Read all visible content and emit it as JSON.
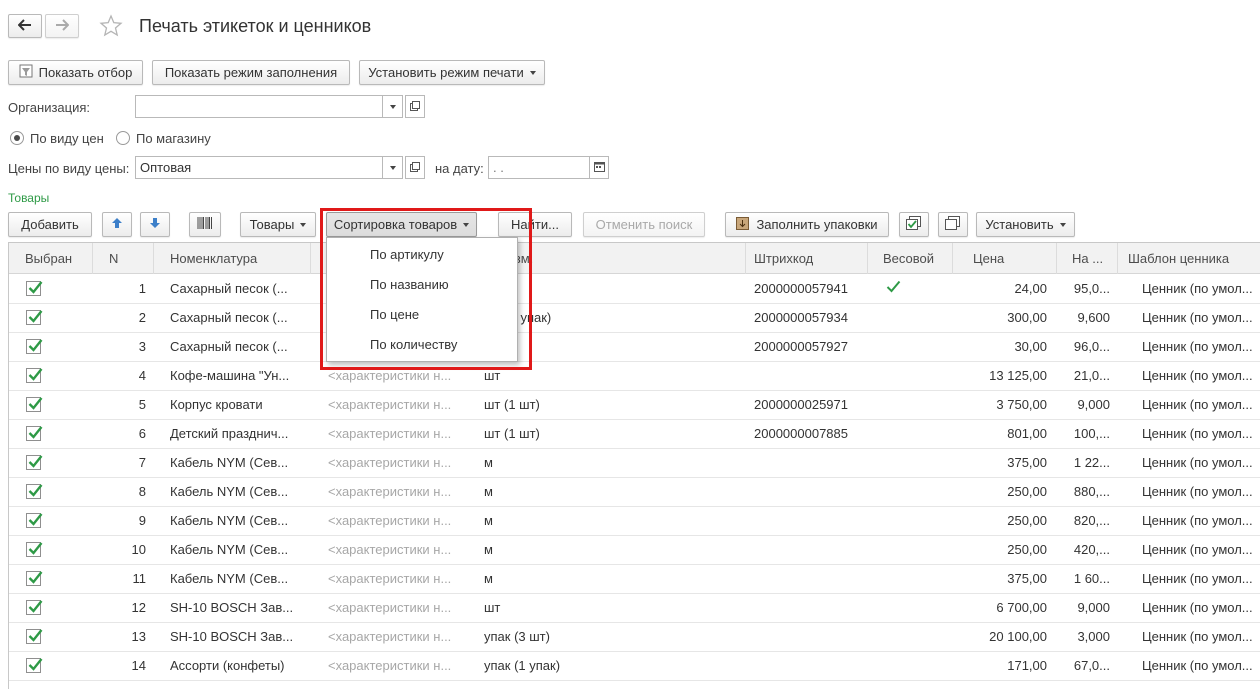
{
  "window": {
    "title": "Печать этикеток и ценников",
    "back_icon": "arrow-left-icon",
    "forward_icon": "arrow-right-icon",
    "favorite_icon": "star-icon"
  },
  "toolbar": {
    "show_filter": "Показать отбор",
    "show_fill_mode": "Показать режим заполнения",
    "set_print_mode": "Установить режим печати"
  },
  "form": {
    "organization_label": "Организация:",
    "organization_value": "",
    "radio_price_type": "По виду цен",
    "radio_store": "По магазину",
    "price_type_label": "Цены по виду цены:",
    "price_type_value": "Оптовая",
    "date_label": "на дату:",
    "date_value": " .  ."
  },
  "goods": {
    "section_title": "Товары",
    "add": "Добавить",
    "goods_menu": "Товары",
    "sort_menu": "Сортировка товаров",
    "find": "Найти...",
    "cancel_search": "Отменить поиск",
    "fill_packages": "Заполнить упаковки",
    "set": "Установить"
  },
  "sort_menu_items": [
    "По артикулу",
    "По названию",
    "По цене",
    "По количеству"
  ],
  "columns": [
    "Выбран",
    "N",
    "Номенклатура",
    "",
    "Ед. изм.",
    "Штрихкод",
    "Весовой",
    "Цена",
    "На ...",
    "Шаблон ценника"
  ],
  "rows": [
    {
      "n": "1",
      "name": "Сахарный песок (...",
      "char": "",
      "unit": "",
      "barcode": "2000000057941",
      "weight": true,
      "price": "24,00",
      "qty": "95,0...",
      "tpl": "Ценник (по умол..."
    },
    {
      "n": "2",
      "name": "Сахарный песок (...",
      "char": "",
      "unit": "кг (10 упак)",
      "barcode": "2000000057934",
      "weight": false,
      "price": "300,00",
      "qty": "9,600",
      "tpl": "Ценник (по умол..."
    },
    {
      "n": "3",
      "name": "Сахарный песок (...",
      "char": "",
      "unit": "",
      "barcode": "2000000057927",
      "weight": false,
      "price": "30,00",
      "qty": "96,0...",
      "tpl": "Ценник (по умол..."
    },
    {
      "n": "4",
      "name": "Кофе-машина \"Ун...",
      "char": "<характеристики н...",
      "unit": "шт",
      "barcode": "",
      "weight": false,
      "price": "13 125,00",
      "qty": "21,0...",
      "tpl": "Ценник (по умол..."
    },
    {
      "n": "5",
      "name": "Корпус кровати",
      "char": "<характеристики н...",
      "unit": "шт (1 шт)",
      "barcode": "2000000025971",
      "weight": false,
      "price": "3 750,00",
      "qty": "9,000",
      "tpl": "Ценник (по умол..."
    },
    {
      "n": "6",
      "name": "Детский празднич...",
      "char": "<характеристики н...",
      "unit": "шт (1 шт)",
      "barcode": "2000000007885",
      "weight": false,
      "price": "801,00",
      "qty": "100,...",
      "tpl": "Ценник (по умол..."
    },
    {
      "n": "7",
      "name": "Кабель NYM (Сев...",
      "char": "<характеристики н...",
      "unit": "м",
      "barcode": "",
      "weight": false,
      "price": "375,00",
      "qty": "1 22...",
      "tpl": "Ценник (по умол..."
    },
    {
      "n": "8",
      "name": "Кабель NYM (Сев...",
      "char": "<характеристики н...",
      "unit": "м",
      "barcode": "",
      "weight": false,
      "price": "250,00",
      "qty": "880,...",
      "tpl": "Ценник (по умол..."
    },
    {
      "n": "9",
      "name": "Кабель NYM (Сев...",
      "char": "<характеристики н...",
      "unit": "м",
      "barcode": "",
      "weight": false,
      "price": "250,00",
      "qty": "820,...",
      "tpl": "Ценник (по умол..."
    },
    {
      "n": "10",
      "name": "Кабель NYM (Сев...",
      "char": "<характеристики н...",
      "unit": "м",
      "barcode": "",
      "weight": false,
      "price": "250,00",
      "qty": "420,...",
      "tpl": "Ценник (по умол..."
    },
    {
      "n": "11",
      "name": "Кабель NYM (Сев...",
      "char": "<характеристики н...",
      "unit": "м",
      "barcode": "",
      "weight": false,
      "price": "375,00",
      "qty": "1 60...",
      "tpl": "Ценник (по умол..."
    },
    {
      "n": "12",
      "name": "SH-10 BOSCH Зав...",
      "char": "<характеристики н...",
      "unit": "шт",
      "barcode": "",
      "weight": false,
      "price": "6 700,00",
      "qty": "9,000",
      "tpl": "Ценник (по умол..."
    },
    {
      "n": "13",
      "name": "SH-10 BOSCH Зав...",
      "char": "<характеристики н...",
      "unit": "упак (3 шт)",
      "barcode": "",
      "weight": false,
      "price": "20 100,00",
      "qty": "3,000",
      "tpl": "Ценник (по умол..."
    },
    {
      "n": "14",
      "name": "Ассорти (конфеты)",
      "char": "<характеристики н...",
      "unit": "упак (1 упак)",
      "barcode": "",
      "weight": false,
      "price": "171,00",
      "qty": "67,0...",
      "tpl": "Ценник (по умол..."
    }
  ],
  "colors": {
    "accent_green": "#2e9a46",
    "highlight_red": "#e01919",
    "arrow_blue": "#3c7fc9"
  }
}
